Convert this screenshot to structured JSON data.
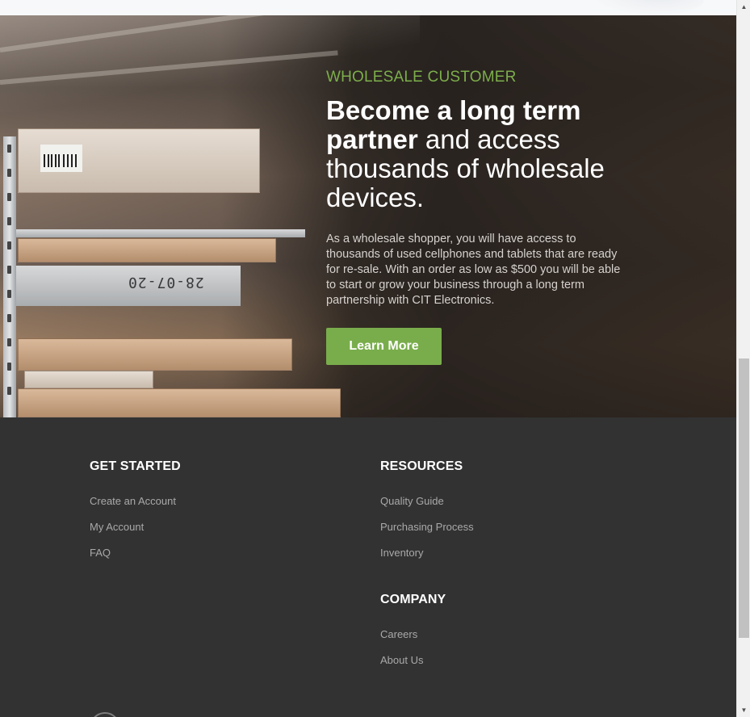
{
  "hero": {
    "eyebrow": "WHOLESALE CUSTOMER",
    "headline_bold": "Become a long term partner",
    "headline_rest": " and access thousands of wholesale devices.",
    "body": "As a wholesale shopper, you will have access to thousands of used cellphones and tablets that are ready for re-sale. With an order as low as $500 you will be able to start or grow your business through a long term partnership with CIT Electronics.",
    "cta_label": "Learn More",
    "shelf_label": "28-07-20"
  },
  "footer": {
    "get_started": {
      "heading": "GET STARTED",
      "links": [
        "Create an Account",
        "My Account",
        "FAQ"
      ]
    },
    "resources": {
      "heading": "RESOURCES",
      "links": [
        "Quality Guide",
        "Purchasing Process",
        "Inventory"
      ]
    },
    "company": {
      "heading": "COMPANY",
      "links": [
        "Careers",
        "About Us"
      ]
    }
  },
  "colors": {
    "accent_green": "#79ad4b",
    "eyebrow_green": "#7cae4b",
    "footer_bg": "#323232"
  },
  "scrollbar": {
    "up_icon": "arrow-up-icon",
    "down_icon": "arrow-down-icon"
  }
}
